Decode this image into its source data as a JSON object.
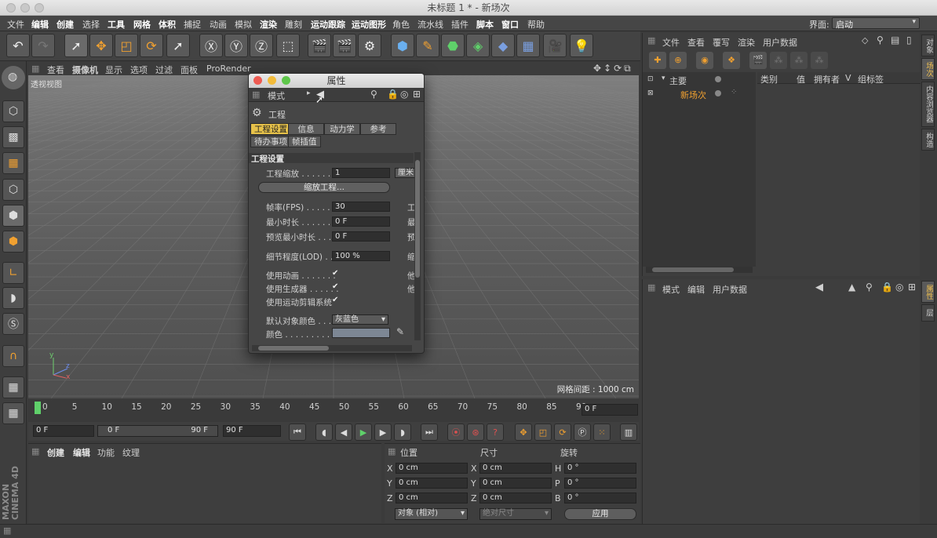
{
  "window": {
    "title": "未标题 1 * - 新场次"
  },
  "menubar": {
    "items": [
      "文件",
      "编辑",
      "创建",
      "选择",
      "工具",
      "网格",
      "体积",
      "捕捉",
      "动画",
      "模拟",
      "渲染",
      "雕刻",
      "运动跟踪",
      "运动图形",
      "角色",
      "流水线",
      "插件",
      "脚本",
      "窗口",
      "帮助"
    ],
    "layout_label": "界面:",
    "layout_value": "启动"
  },
  "viewport": {
    "menu": [
      "查看",
      "摄像机",
      "显示",
      "选项",
      "过滤",
      "面板",
      "ProRender"
    ],
    "view_name": "透视视图",
    "grid_info": "网格间距 : 1000 cm",
    "axes": {
      "y": "y",
      "z": "z",
      "x": "x"
    }
  },
  "attributes_dialog": {
    "title": "属性",
    "mode_label": "模式",
    "object_name": "工程",
    "tabs_row1": [
      "工程设置",
      "信息",
      "动力学",
      "参考"
    ],
    "tabs_row2": [
      "待办事项",
      "帧插值"
    ],
    "section_title": "工程设置",
    "project_scale_label": "工程缩放 . . . . . . .",
    "project_scale_value": "1",
    "project_scale_unit": "厘米",
    "scale_project_button": "缩放工程...",
    "fps_label": "帧率(FPS) . . . . . . .",
    "fps_value": "30",
    "min_time_label": "最小时长 . . . . . . . .",
    "min_time_value": "0 F",
    "preview_min_label": "预览最小时长 . . . .",
    "preview_min_value": "0 F",
    "lod_label": "细节程度(LOD) . .",
    "lod_value": "100 %",
    "use_animation_label": "使用动画 . . . . . . .",
    "use_generators_label": "使用生成器 . . . . . .",
    "use_motion_label": "使用运动剪辑系统",
    "default_color_label": "默认对象颜色 . . .",
    "default_color_value": "灰蓝色",
    "color_label": "颜色 . . . . . . . . . .",
    "side_letters": [
      "工",
      "最",
      "预",
      "缩",
      "他",
      "他"
    ]
  },
  "object_manager": {
    "menu": [
      "文件",
      "查看",
      "覆写",
      "渲染",
      "用户数据"
    ],
    "columns": [
      "类别",
      "值",
      "拥有者",
      "V",
      "组标签"
    ],
    "items": [
      {
        "name": "主要"
      },
      {
        "name": "新场次"
      }
    ]
  },
  "attribute_panel": {
    "menu": [
      "模式",
      "编辑",
      "用户数据"
    ]
  },
  "side_tabs_top": [
    "对象",
    "场次",
    "内容浏览器",
    "构造"
  ],
  "side_tabs_bottom": [
    "属性",
    "层"
  ],
  "timeline": {
    "ticks": [
      "0",
      "5",
      "10",
      "15",
      "20",
      "25",
      "30",
      "35",
      "40",
      "45",
      "50",
      "55",
      "60",
      "65",
      "70",
      "75",
      "80",
      "85",
      "90"
    ],
    "current_frame": "0 F"
  },
  "transport": {
    "start_field": "0 F",
    "range_start": "0 F",
    "range_end": "90 F",
    "end_field": "90 F"
  },
  "material_panel": {
    "menu": [
      "创建",
      "编辑",
      "功能",
      "纹理"
    ]
  },
  "coordinates": {
    "headers": [
      "位置",
      "尺寸",
      "旋转"
    ],
    "rows": [
      {
        "a": "X",
        "pos": "0 cm",
        "b": "X",
        "size": "0 cm",
        "c": "H",
        "rot": "0 °"
      },
      {
        "a": "Y",
        "pos": "0 cm",
        "b": "Y",
        "size": "0 cm",
        "c": "P",
        "rot": "0 °"
      },
      {
        "a": "Z",
        "pos": "0 cm",
        "b": "Z",
        "size": "0 cm",
        "c": "B",
        "rot": "0 °"
      }
    ],
    "mode_dropdown": "对象 (相对)",
    "size_dropdown": "绝对尺寸",
    "apply_button": "应用"
  },
  "branding": {
    "logo_line1": "MAXON",
    "logo_line2": "CINEMA 4D"
  },
  "colors": {
    "accent": "#e7c24a",
    "orange_text": "#f0a030",
    "background": "#3b3b3b"
  }
}
